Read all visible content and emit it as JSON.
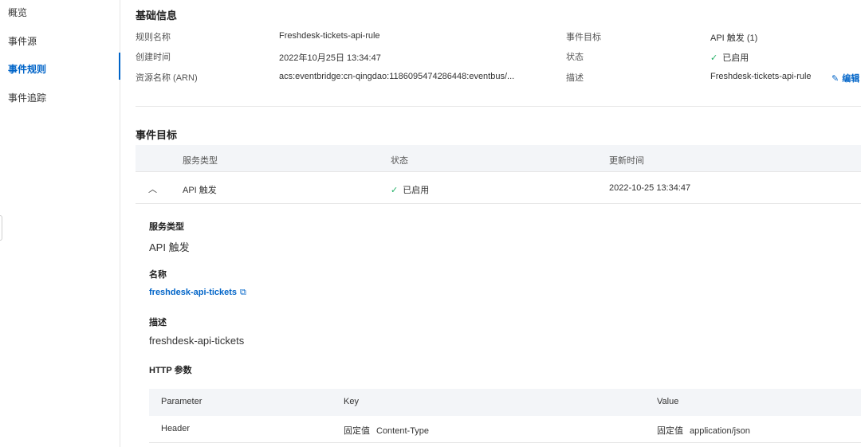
{
  "sidebar": {
    "items": [
      {
        "label": "概览"
      },
      {
        "label": "事件源"
      },
      {
        "label": "事件规则"
      },
      {
        "label": "事件追踪"
      }
    ],
    "active": "事件规则"
  },
  "basic_info": {
    "title": "基础信息",
    "rule_name_label": "规则名称",
    "rule_name_value": "Freshdesk-tickets-api-rule",
    "created_label": "创建时间",
    "created_value": "2022年10月25日 13:34:47",
    "arn_label": "资源名称 (ARN)",
    "arn_value": "acs:eventbridge:cn-qingdao:1186095474286448:eventbus/...",
    "target_label": "事件目标",
    "target_value": "API 触发 (1)",
    "status_label": "状态",
    "status_value": "已启用",
    "desc_label": "描述",
    "desc_value": "Freshdesk-tickets-api-rule",
    "edit_label": "编辑"
  },
  "targets": {
    "title": "事件目标",
    "columns": [
      "服务类型",
      "状态",
      "更新时间"
    ],
    "row": {
      "service": "API 触发",
      "status": "已启用",
      "updated": "2022-10-25 13:34:47"
    }
  },
  "detail": {
    "service_type_label": "服务类型",
    "service_type_value": "API 触发",
    "name_label": "名称",
    "name_value": "freshdesk-api-tickets",
    "desc_label": "描述",
    "desc_value": "freshdesk-api-tickets",
    "http_params_label": "HTTP 参数"
  },
  "http_params": {
    "columns": [
      "Parameter",
      "Key",
      "Value"
    ],
    "rows": [
      {
        "parameter": "Header",
        "key_tag": "固定值",
        "key": "Content-Type",
        "value_tag": "固定值",
        "value": "application/json"
      }
    ]
  },
  "icons": {
    "check": "check-icon",
    "chevron": "chevron-up-icon",
    "external": "external-link-icon",
    "edit": "pencil-icon"
  },
  "colors": {
    "accent": "#0064c8",
    "success": "#23b066",
    "table_header_bg": "#f3f5f8"
  }
}
